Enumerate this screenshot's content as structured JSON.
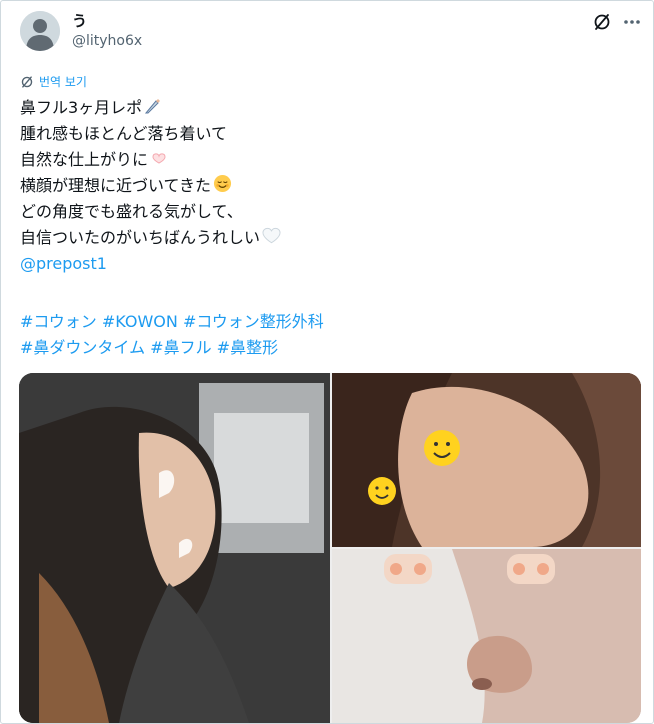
{
  "author": {
    "name": "う",
    "handle": "@lityho6x"
  },
  "icons": {
    "translate": "translate-icon",
    "more": "more-dots-icon"
  },
  "translate_label": "번역 보기",
  "lines": [
    "鼻フル3ヶ月レポ",
    "腫れ感もほとんど落ち着いて",
    "自然な仕上がりに",
    "横顔が理想に近づいてきた",
    "どの角度でも盛れる気がして、",
    "自信ついたのがいちばんうれしい"
  ],
  "mention": "@prepost1",
  "hashtags": {
    "line1": "#コウォン #KOWON #コウォン整形外科",
    "line2": "#鼻ダウンタイム #鼻フル #鼻整形"
  },
  "colors": {
    "link": "#1d9bf0",
    "muted": "#536471",
    "text": "#0f1419"
  }
}
